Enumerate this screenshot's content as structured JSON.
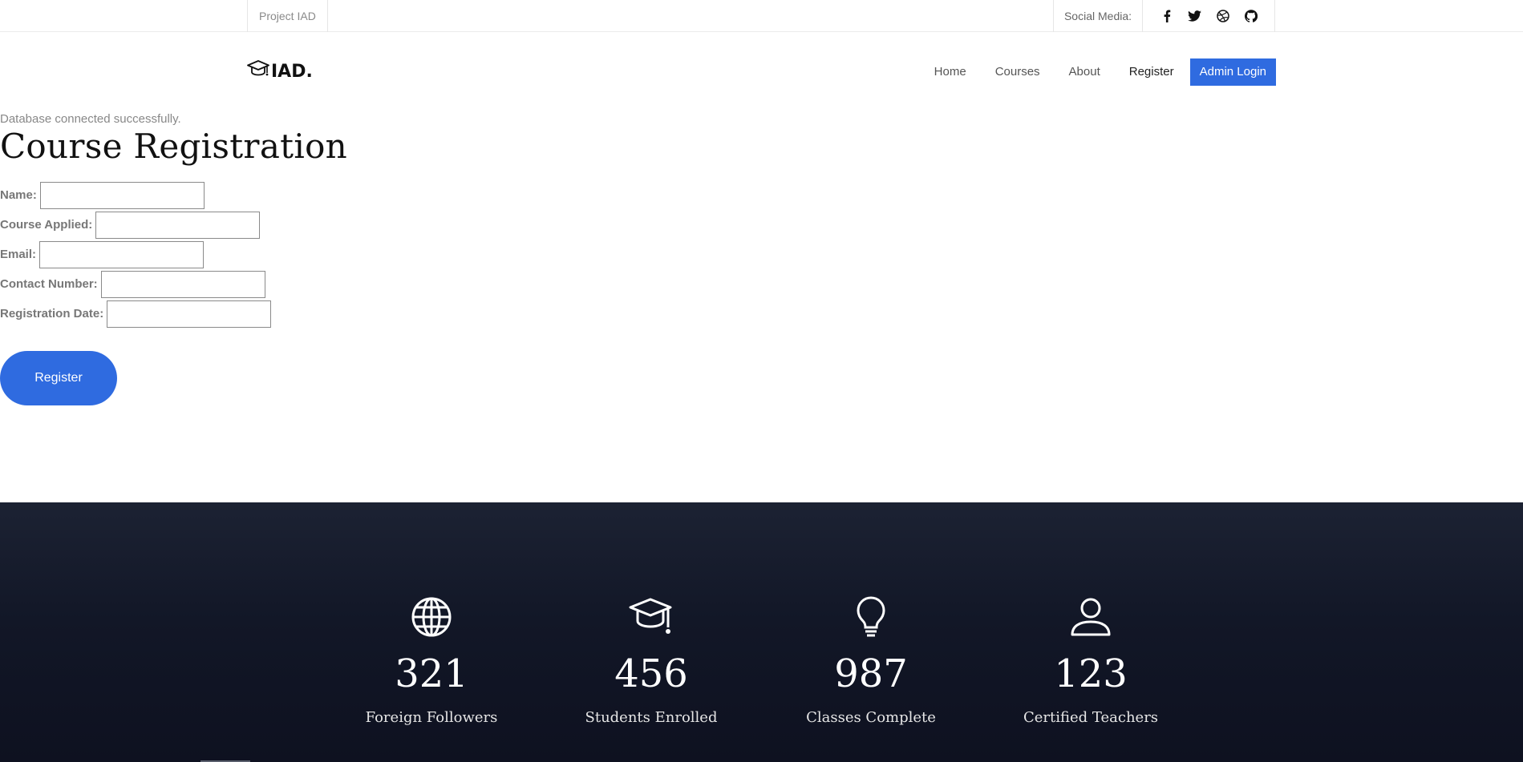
{
  "topbar": {
    "brand": "Project IAD",
    "social_label": "Social Media:",
    "social_icons": [
      "facebook-icon",
      "twitter-icon",
      "dribbble-icon",
      "github-icon"
    ]
  },
  "header": {
    "logo_text": "IAD.",
    "logo_icon": "graduation-cap-icon",
    "nav": {
      "home": "Home",
      "courses": "Courses",
      "about": "About",
      "register": "Register",
      "admin_login": "Admin Login"
    }
  },
  "main": {
    "db_status": "Database connected successfully.",
    "title": "Course Registration",
    "fields": {
      "name": {
        "label": "Name:",
        "value": ""
      },
      "course": {
        "label": "Course Applied:",
        "value": ""
      },
      "email": {
        "label": "Email:",
        "value": ""
      },
      "contact": {
        "label": "Contact Number:",
        "value": ""
      },
      "date": {
        "label": "Registration Date:",
        "value": ""
      }
    },
    "submit_label": "Register"
  },
  "stats": [
    {
      "icon": "globe-icon",
      "value": "321",
      "label": "Foreign Followers"
    },
    {
      "icon": "graduation-cap-icon",
      "value": "456",
      "label": "Students Enrolled"
    },
    {
      "icon": "lightbulb-icon",
      "value": "987",
      "label": "Classes Complete"
    },
    {
      "icon": "user-icon",
      "value": "123",
      "label": "Certified Teachers"
    }
  ],
  "colors": {
    "accent": "#2f6be0",
    "stats_bg": "#121727"
  }
}
